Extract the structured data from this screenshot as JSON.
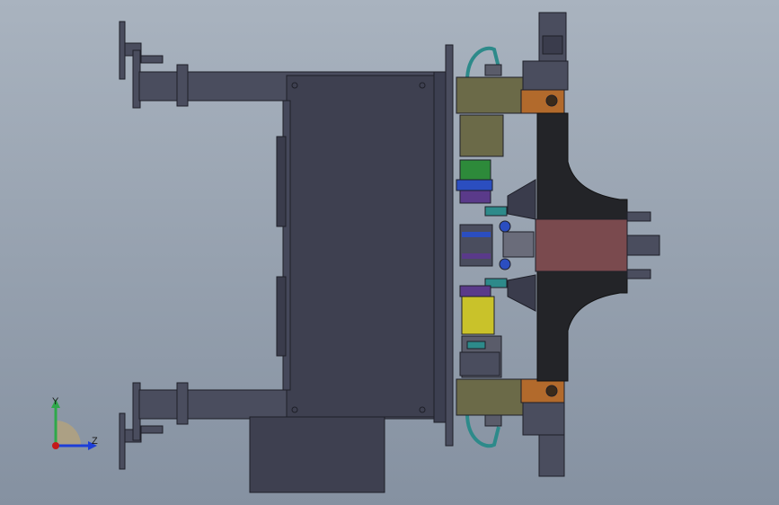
{
  "view": {
    "background_top": "#a9b3bf",
    "background_bottom": "#8591a1"
  },
  "triad": {
    "y_label": "Y",
    "z_label": "Z",
    "y_color": "#2ea84a",
    "z_color": "#1d3ed8",
    "x_color": "#c41a1a"
  },
  "colors": {
    "frame": "#4a4d5e",
    "frame_dark": "#2c2e3a",
    "panel": "#3e4050",
    "base_black": "#232428",
    "brown": "#b26a2c",
    "olive": "#6b6a48",
    "yellow": "#c9c22a",
    "maroon": "#7a4a4e",
    "teal": "#2d8a8a",
    "blue": "#2b4ec0",
    "green": "#2d8a3a",
    "purple": "#5a3a8a"
  }
}
